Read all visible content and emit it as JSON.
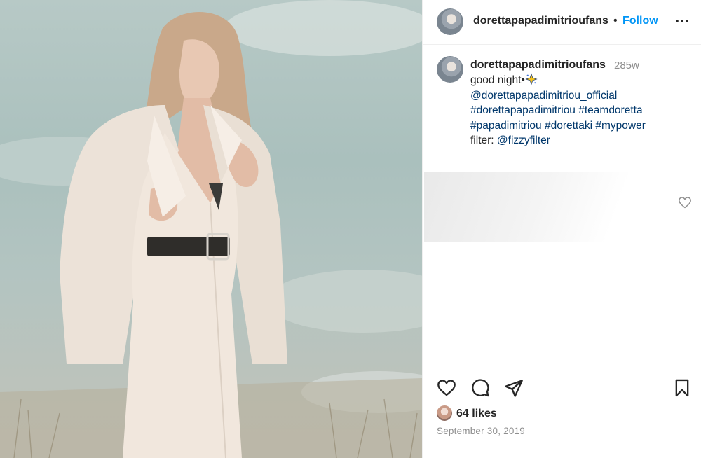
{
  "post": {
    "username": "dorettapapadimitrioufans",
    "separator": "•",
    "follow_label": "Follow",
    "more_icon": "more-options-icon",
    "photo_alt": "woman in white blazer and belted dress against a pale sky",
    "caption": {
      "username": "dorettapapadimitrioufans",
      "time_ago": "285w",
      "line1_text": "good night•",
      "line1_emoji": "sparkle-star-icon",
      "mention_official": "@dorettapapadimitriou_official",
      "hashtags_line1": "#dorettapapadimitriou #teamdoretta",
      "hashtags_line2": "#papadimitriou #dorettaki #mypower",
      "filter_label": "filter:",
      "filter_mention": "@fizzyfilter"
    },
    "likes": "64 likes",
    "date": "September 30, 2019"
  },
  "icons": [
    "heart-icon",
    "comment-icon",
    "share-icon",
    "bookmark-icon",
    "small-heart-icon"
  ],
  "colors": {
    "follow_blue": "#0095f6",
    "link_navy": "#00376b",
    "muted_gray": "#8e8e8e",
    "text": "#262626"
  }
}
